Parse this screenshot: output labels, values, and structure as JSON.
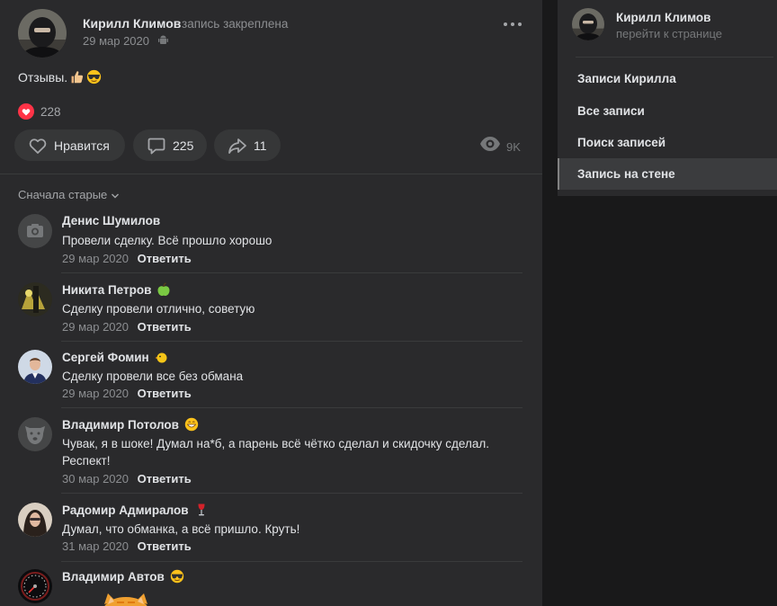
{
  "post": {
    "author_name": "Кирилл Климов",
    "pinned_note": "запись закреплена",
    "date": "29 мар 2020",
    "text": "Отзывы.",
    "reactions_count": "228",
    "like_label": "Нравится",
    "comments_count": "225",
    "shares_count": "11",
    "views_count": "9K"
  },
  "comments_header": {
    "sort_label": "Сначала старые"
  },
  "comments": [
    {
      "author": "Денис Шумилов",
      "text": "Провели сделку. Всё прошло хорошо",
      "date": "29 мар 2020",
      "reply": "Ответить"
    },
    {
      "author": "Никита Петров",
      "text": "Сделку провели отлично, советую",
      "date": "29 мар 2020",
      "reply": "Ответить"
    },
    {
      "author": "Сергей Фомин",
      "text": "Сделку провели все без обмана",
      "date": "29 мар 2020",
      "reply": "Ответить"
    },
    {
      "author": "Владимир Потолов",
      "text": "Чувак, я в шоке! Думал на*б, а парень всё чётко сделал и скидочку сделал. Респект!",
      "date": "30 мар 2020",
      "reply": "Ответить"
    },
    {
      "author": "Радомир Адмиралов",
      "text": "Думал, что обманка, а всё пришло. Круть!",
      "date": "31 мар 2020",
      "reply": "Ответить"
    },
    {
      "author": "Владимир Автов"
    }
  ],
  "sidebar": {
    "profile_name": "Кирилл Климов",
    "profile_link": "перейти к странице",
    "items": [
      {
        "label": "Записи Кирилла"
      },
      {
        "label": "Все записи"
      },
      {
        "label": "Поиск записей"
      },
      {
        "label": "Запись на стене"
      }
    ]
  },
  "colors": {
    "page_bg": "#19191a",
    "card_bg": "#2a2a2c",
    "button_bg": "#363738",
    "reaction_heart": "#ff3347",
    "muted_text": "#8c8e91"
  },
  "icons": [
    "more-icon",
    "android-icon",
    "heart-icon",
    "comment-icon",
    "share-icon",
    "eye-icon",
    "chevron-down-icon",
    "camera-icon"
  ]
}
